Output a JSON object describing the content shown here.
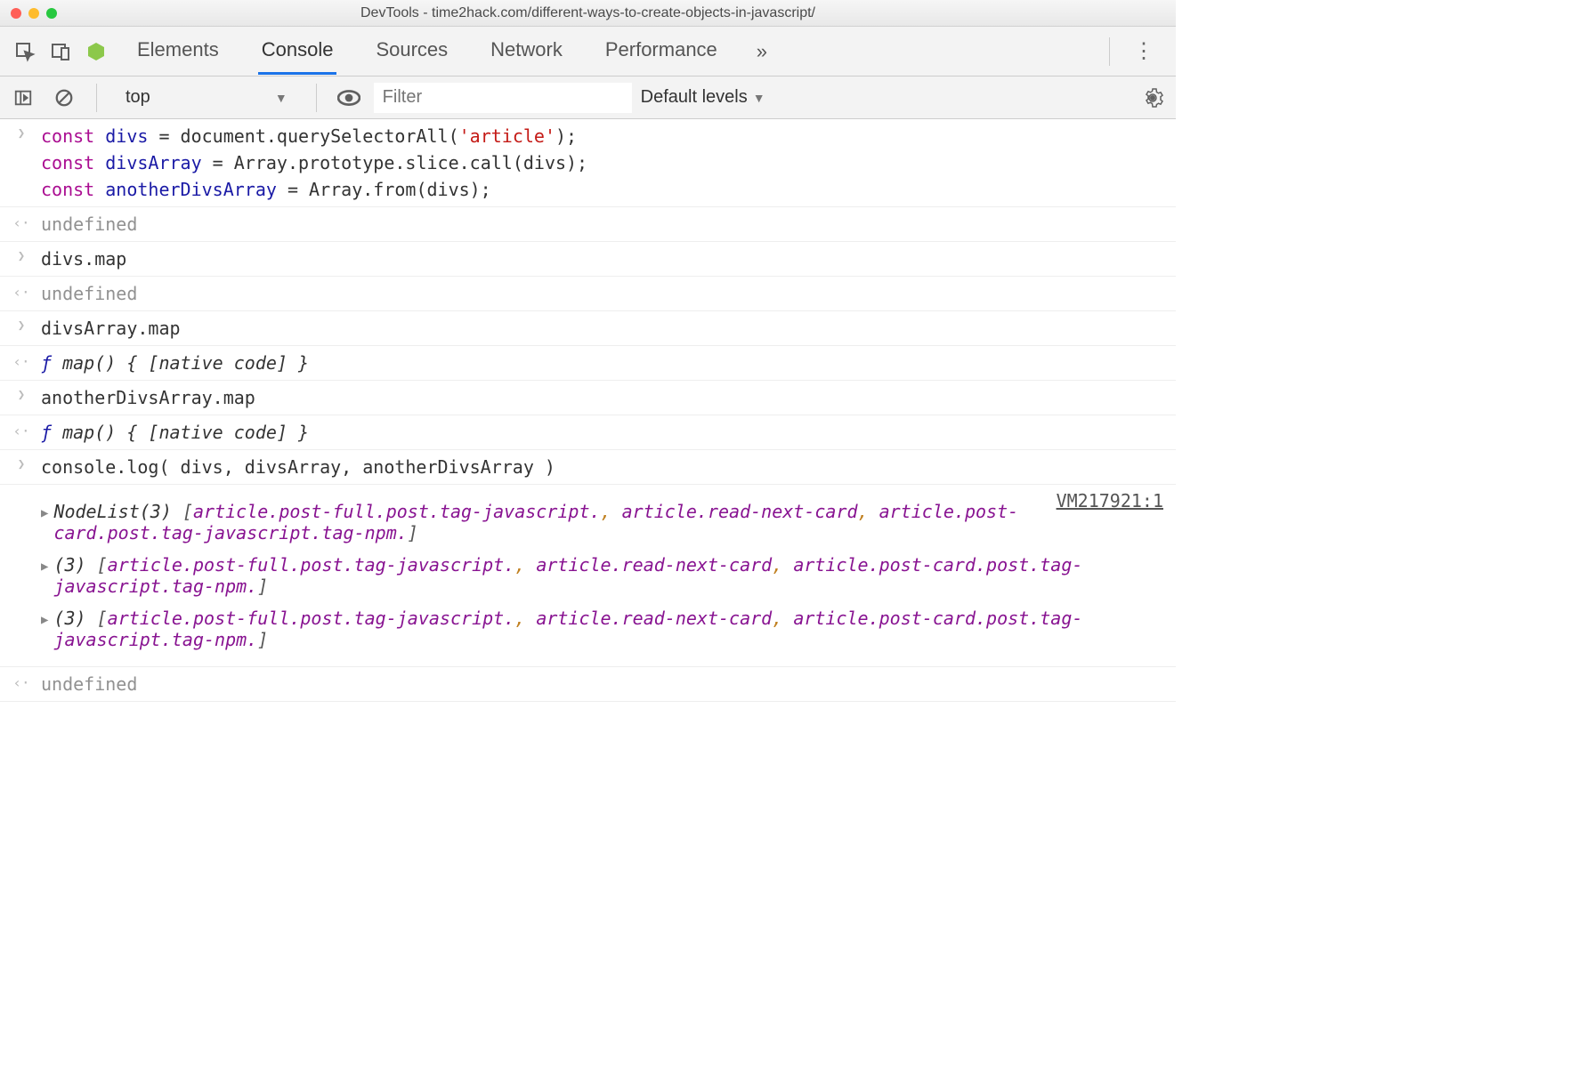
{
  "window": {
    "title": "DevTools - time2hack.com/different-ways-to-create-objects-in-javascript/"
  },
  "tabs": {
    "items": [
      "Elements",
      "Console",
      "Sources",
      "Network",
      "Performance"
    ],
    "active_index": 1,
    "overflow": "»"
  },
  "toolbar": {
    "context": "top",
    "filter_placeholder": "Filter",
    "levels_label": "Default levels"
  },
  "console": {
    "entries": [
      {
        "type": "input",
        "code": {
          "lines": [
            [
              {
                "t": "const ",
                "c": "kw"
              },
              {
                "t": "divs",
                "c": "ident"
              },
              {
                "t": " = document.querySelectorAll(",
                "c": "punct"
              },
              {
                "t": "'article'",
                "c": "str"
              },
              {
                "t": ");",
                "c": "punct"
              }
            ],
            [
              {
                "t": "const ",
                "c": "kw"
              },
              {
                "t": "divsArray",
                "c": "ident"
              },
              {
                "t": " = Array.prototype.slice.call(divs);",
                "c": "punct"
              }
            ],
            [
              {
                "t": "const ",
                "c": "kw"
              },
              {
                "t": "anotherDivsArray",
                "c": "ident"
              },
              {
                "t": " = Array.from(divs);",
                "c": "punct"
              }
            ]
          ]
        }
      },
      {
        "type": "output",
        "text": "undefined",
        "class": "grey"
      },
      {
        "type": "input",
        "code": {
          "lines": [
            [
              {
                "t": "divs.map",
                "c": "punct"
              }
            ]
          ]
        }
      },
      {
        "type": "output",
        "text": "undefined",
        "class": "grey"
      },
      {
        "type": "input",
        "code": {
          "lines": [
            [
              {
                "t": "divsArray.map",
                "c": "punct"
              }
            ]
          ]
        }
      },
      {
        "type": "output",
        "spans": [
          {
            "t": "ƒ ",
            "c": "func-f"
          },
          {
            "t": "map() { [native code] }",
            "c": "native"
          }
        ]
      },
      {
        "type": "input",
        "code": {
          "lines": [
            [
              {
                "t": "anotherDivsArray.map",
                "c": "punct"
              }
            ]
          ]
        }
      },
      {
        "type": "output",
        "spans": [
          {
            "t": "ƒ ",
            "c": "func-f"
          },
          {
            "t": "map() { [native code] }",
            "c": "native"
          }
        ]
      },
      {
        "type": "input",
        "code": {
          "lines": [
            [
              {
                "t": "console.log( divs, divsArray, anotherDivsArray )",
                "c": "punct"
              }
            ]
          ]
        }
      },
      {
        "type": "log",
        "source_link": "VM217921:1",
        "items": [
          {
            "prefix": "NodeList(3) ",
            "elements": [
              "article.post-full.post.tag-javascript.",
              "article.read-next-card",
              "article.post-card.post.tag-javascript.tag-npm."
            ]
          },
          {
            "prefix": "(3) ",
            "elements": [
              "article.post-full.post.tag-javascript.",
              "article.read-next-card",
              "article.post-card.post.tag-javascript.tag-npm."
            ]
          },
          {
            "prefix": "(3) ",
            "elements": [
              "article.post-full.post.tag-javascript.",
              "article.read-next-card",
              "article.post-card.post.tag-javascript.tag-npm."
            ]
          }
        ]
      },
      {
        "type": "output",
        "text": "undefined",
        "class": "grey"
      }
    ]
  }
}
